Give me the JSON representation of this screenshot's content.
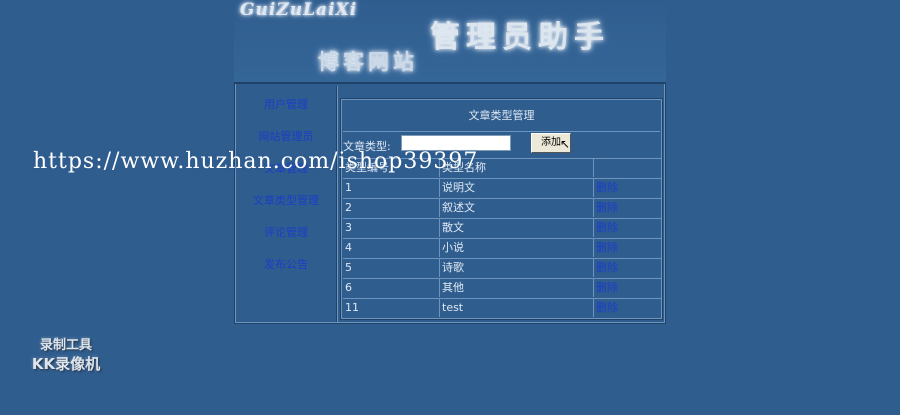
{
  "header": {
    "logo_en": "GuiZuLaiXi",
    "logo_admin": "管理员助手",
    "logo_blog": "博客网站"
  },
  "sidebar": {
    "items": [
      {
        "label": "用户管理"
      },
      {
        "label": "网站管理员"
      },
      {
        "label": "文章管理"
      },
      {
        "label": "文章类型管理"
      },
      {
        "label": "评论管理"
      },
      {
        "label": "发布公告"
      }
    ]
  },
  "main": {
    "title": "文章类型管理",
    "form": {
      "label": "文章类型:",
      "input_value": "",
      "add_label": "添加"
    },
    "table": {
      "headers": [
        "类型编号",
        "类型名称",
        ""
      ],
      "rows": [
        {
          "id": "1",
          "name": "说明文",
          "action": "删除"
        },
        {
          "id": "2",
          "name": "叙述文",
          "action": "删除"
        },
        {
          "id": "3",
          "name": "散文",
          "action": "删除"
        },
        {
          "id": "4",
          "name": "小说",
          "action": "删除"
        },
        {
          "id": "5",
          "name": "诗歌",
          "action": "删除"
        },
        {
          "id": "6",
          "name": "其他",
          "action": "删除"
        },
        {
          "id": "11",
          "name": "test",
          "action": "删除"
        }
      ]
    }
  },
  "overlay": {
    "watermark": "https://www.huzhan.com/ishop39397",
    "recorder_line1": "录制工具",
    "recorder_line2": "KK录像机"
  },
  "colors": {
    "background": "#2f5d8e",
    "link": "#1a3ec8",
    "text": "#dfe8f3"
  }
}
